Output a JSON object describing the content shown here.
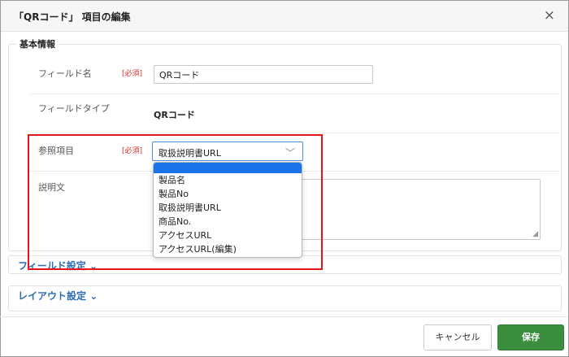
{
  "dialog": {
    "title": "「QRコード」 項目の編集",
    "close_symbol": "×"
  },
  "basic_section": {
    "legend": "基本情報",
    "field_name": {
      "label": "フィールド名",
      "required": "[必須]",
      "value": "QRコード"
    },
    "field_type": {
      "label": "フィールドタイプ",
      "value": "QRコード"
    },
    "reference": {
      "label": "参照項目",
      "required": "[必須]",
      "selected": "取扱説明書URL",
      "options": [
        "",
        "製品名",
        "製品No",
        "取扱説明書URL",
        "商品No.",
        "アクセスURL",
        "アクセスURL(編集)"
      ]
    },
    "description": {
      "label": "説明文",
      "value": ""
    }
  },
  "field_settings": {
    "label": "フィールド設定"
  },
  "layout_settings": {
    "label": "レイアウト設定"
  },
  "footer": {
    "cancel_label": "キャンセル",
    "save_label": "保存"
  },
  "colors": {
    "save_button": "#3a8e3d",
    "highlight_border": "#e8141a",
    "link": "#2a6db5",
    "selected_option": "#1a73e8"
  },
  "icons": [
    "close-icon",
    "chevron-down-icon",
    "resize-grip-icon"
  ]
}
